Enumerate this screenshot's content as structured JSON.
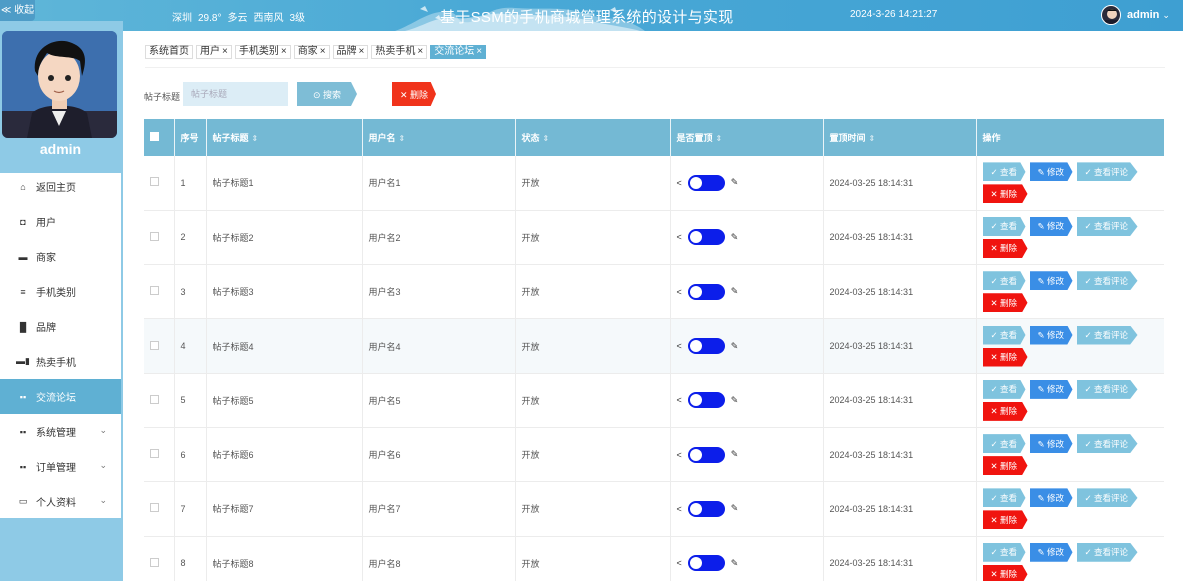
{
  "header": {
    "collapse_label": "≪ 收起",
    "weather": {
      "city": "深圳",
      "temp": "29.8°",
      "condition": "多云",
      "wind": "西南风",
      "level": "3级"
    },
    "title": "基于SSM的手机商城管理系统的设计与实现",
    "datetime": "2024-3-26 14:21:27",
    "user": "admin",
    "caret": "⌄"
  },
  "sidebar": {
    "username": "admin",
    "items": [
      {
        "icon": "⌂",
        "label": "返回主页",
        "icon_name": "home-icon"
      },
      {
        "icon": "◘",
        "label": "用户",
        "icon_name": "user-icon"
      },
      {
        "icon": "▬",
        "label": "商家",
        "icon_name": "shop-icon"
      },
      {
        "icon": "≡",
        "label": "手机类别",
        "icon_name": "list-icon"
      },
      {
        "icon": "▐▌",
        "label": "品牌",
        "icon_name": "brand-icon"
      },
      {
        "icon": "▬▮",
        "label": "热卖手机",
        "icon_name": "phone-icon"
      },
      {
        "icon": "▪▪",
        "label": "交流论坛",
        "icon_name": "forum-icon"
      },
      {
        "icon": "▪▪",
        "label": "系统管理",
        "icon_name": "system-icon",
        "chevron": "⌄"
      },
      {
        "icon": "▪▪",
        "label": "订单管理",
        "icon_name": "order-icon",
        "chevron": "⌄"
      },
      {
        "icon": "▭",
        "label": "个人资料",
        "icon_name": "profile-icon",
        "chevron": "⌄"
      }
    ],
    "active_index": 6
  },
  "tabs": [
    {
      "label": "系统首页",
      "closable": false
    },
    {
      "label": "用户",
      "closable": true
    },
    {
      "label": "手机类别",
      "closable": true
    },
    {
      "label": "商家",
      "closable": true
    },
    {
      "label": "品牌",
      "closable": true
    },
    {
      "label": "热卖手机",
      "closable": true
    },
    {
      "label": "交流论坛",
      "closable": true,
      "active": true
    }
  ],
  "tab_close": "×",
  "search": {
    "label": "帖子标题",
    "placeholder": "帖子标题",
    "button": "⊙ 搜索",
    "delete_button": "✕ 删除"
  },
  "table": {
    "columns": [
      "序号",
      "帖子标题",
      "用户名",
      "状态",
      "是否置顶",
      "置顶时间",
      "操作"
    ],
    "sort_icon": "⇕",
    "rows": [
      {
        "idx": "1",
        "title": "帖子标题1",
        "user": "用户名1",
        "status": "开放",
        "time": "2024-03-25 18:14:31"
      },
      {
        "idx": "2",
        "title": "帖子标题2",
        "user": "用户名2",
        "status": "开放",
        "time": "2024-03-25 18:14:31"
      },
      {
        "idx": "3",
        "title": "帖子标题3",
        "user": "用户名3",
        "status": "开放",
        "time": "2024-03-25 18:14:31"
      },
      {
        "idx": "4",
        "title": "帖子标题4",
        "user": "用户名4",
        "status": "开放",
        "time": "2024-03-25 18:14:31"
      },
      {
        "idx": "5",
        "title": "帖子标题5",
        "user": "用户名5",
        "status": "开放",
        "time": "2024-03-25 18:14:31"
      },
      {
        "idx": "6",
        "title": "帖子标题6",
        "user": "用户名6",
        "status": "开放",
        "time": "2024-03-25 18:14:31"
      },
      {
        "idx": "7",
        "title": "帖子标题7",
        "user": "用户名7",
        "status": "开放",
        "time": "2024-03-25 18:14:31"
      },
      {
        "idx": "8",
        "title": "帖子标题8",
        "user": "用户名8",
        "status": "开放",
        "time": "2024-03-25 18:14:31"
      }
    ],
    "ops": {
      "view": "✓ 查看",
      "edit": "✎ 修改",
      "comments": "✓ 查看评论",
      "delete": "✕ 删除"
    },
    "share_glyph": "<",
    "pen_glyph": "✎"
  },
  "colors": {
    "accent": "#5fb0d3",
    "header": "#4aa9d6",
    "danger": "#f0331b",
    "toggle": "#0c1eea"
  }
}
